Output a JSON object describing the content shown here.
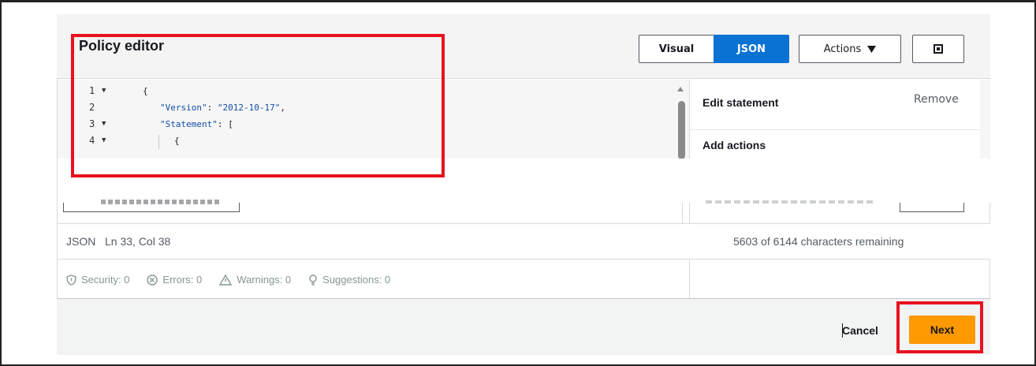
{
  "header": {
    "title": "Policy editor",
    "tabs": [
      {
        "label": "Visual",
        "selected": false
      },
      {
        "label": "JSON",
        "selected": true
      }
    ],
    "actions_label": "Actions",
    "accent_color": "#0972d3"
  },
  "editor": {
    "lines": [
      {
        "num": "1",
        "fold": true,
        "code": "{"
      },
      {
        "num": "2",
        "fold": false,
        "key": "\"Version\"",
        "sep": ": ",
        "value": "\"2012-10-17\"",
        "tail": ","
      },
      {
        "num": "3",
        "fold": true,
        "key": "\"Statement\"",
        "sep": ": ",
        "tail": "["
      },
      {
        "num": "4",
        "fold": true,
        "code": "{"
      }
    ]
  },
  "side_panel": {
    "edit_statement": "Edit statement",
    "remove": "Remove",
    "add_actions": "Add actions"
  },
  "statusbar": {
    "position": "JSON   Ln 33, Col 38",
    "chars_remaining": "5603 of 6144 characters remaining"
  },
  "validators": {
    "security": "Security: 0",
    "errors": "Errors: 0",
    "warnings": "Warnings: 0",
    "suggestions": "Suggestions: 0"
  },
  "footer": {
    "cancel_label": "Cancel",
    "next_label": "Next",
    "next_color": "#ff9900"
  },
  "annotations": {
    "highlight_color": "#e8121f"
  }
}
